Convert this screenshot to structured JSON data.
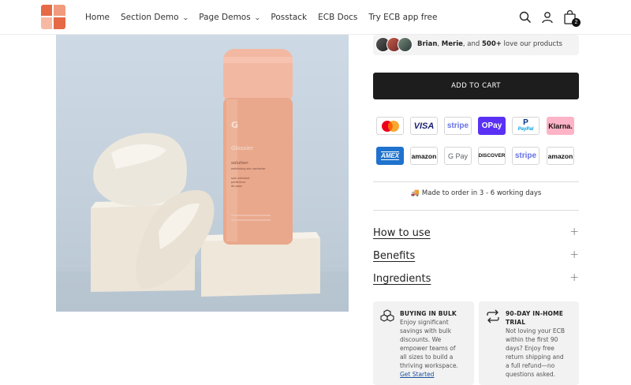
{
  "header": {
    "nav": [
      {
        "label": "Home",
        "has_dropdown": false
      },
      {
        "label": "Section Demo",
        "has_dropdown": true
      },
      {
        "label": "Page Demos",
        "has_dropdown": true
      },
      {
        "label": "Posstack",
        "has_dropdown": false
      },
      {
        "label": "ECB Docs",
        "has_dropdown": false
      },
      {
        "label": "Try ECB app free",
        "has_dropdown": false
      }
    ],
    "icons": [
      "search-icon",
      "account-icon",
      "cart-icon"
    ],
    "cart_count": "2",
    "logo_colors": [
      "#e56a45",
      "#f29a7d",
      "#f8b9a3",
      "#e56a45"
    ]
  },
  "product_image": {
    "bottle_brand": "Glossier",
    "bottle_name": "solution",
    "bottle_sub": "exfoliating skin perfector",
    "bottle_fr1": "soin exfoliant",
    "bottle_fr2": "perfecteur",
    "bottle_fr3": "de peau"
  },
  "social_proof": {
    "name1": "Brian",
    "name2": "Merie",
    "and": ", and ",
    "count": "500+",
    "suffix": " love our products"
  },
  "add_to_cart_label": "ADD TO CART",
  "payment_methods": {
    "row1": [
      "mastercard",
      "VISA",
      "stripe",
      "OPay",
      "PayPal",
      "Klarna."
    ],
    "row2": [
      "AMEX",
      "amazon",
      "G Pay",
      "DISCOVER",
      "stripe",
      "amazon"
    ]
  },
  "shipping_note": "Made to order in 3 - 6 working days",
  "accordions": [
    {
      "title": "How to use"
    },
    {
      "title": "Benefits"
    },
    {
      "title": "Ingredients"
    }
  ],
  "cards": [
    {
      "title_line1": "BUYING IN BULK",
      "body_lines": [
        "Enjoy significant",
        "savings with bulk",
        "discounts. We",
        "empower teams of",
        "all sizes to build a",
        "thriving workspace."
      ],
      "link": "Get Started"
    },
    {
      "title_line1": "90-DAY IN-HOME",
      "title_line2": "TRIAL",
      "body_lines": [
        "Not loving your ECB",
        "within the first 90",
        "days? Enjoy free",
        "return shipping and",
        "a full refund—no",
        "questions asked."
      ]
    }
  ]
}
